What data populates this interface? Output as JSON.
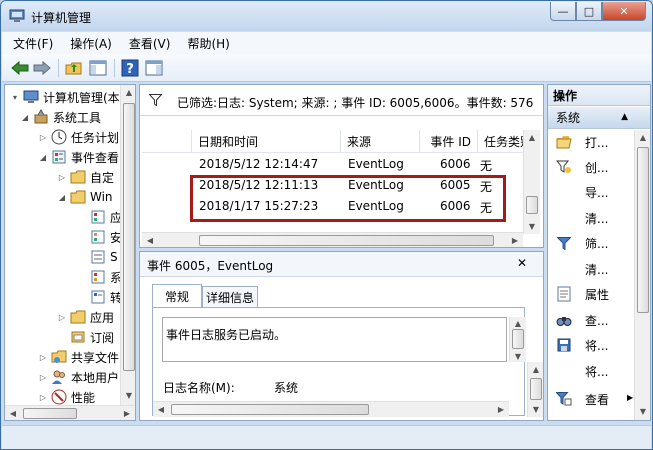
{
  "window": {
    "title": "计算机管理",
    "controls": {
      "minimize": "—",
      "maximize": "□",
      "close": "✕"
    }
  },
  "menu": [
    "文件(F)",
    "操作(A)",
    "查看(V)",
    "帮助(H)"
  ],
  "tree": {
    "items": [
      {
        "label": "计算机管理(本地",
        "icon": "computer-management-icon",
        "expander": "▾"
      },
      {
        "label": "系统工具",
        "icon": "system-tools-icon",
        "expander": "◢"
      },
      {
        "label": "任务计划",
        "icon": "clock-icon",
        "expander": "▷"
      },
      {
        "label": "事件查看",
        "icon": "event-viewer-icon",
        "expander": "◢"
      },
      {
        "label": "自定",
        "icon": "folder-icon",
        "expander": "▷"
      },
      {
        "label": "Win",
        "icon": "folder-icon",
        "expander": "◢"
      },
      {
        "label": "应用",
        "icon": "folder-icon",
        "expander": "▷"
      },
      {
        "label": "订阅",
        "icon": "subscription-icon",
        "expander": ""
      },
      {
        "label": "共享文件",
        "icon": "shared-folders-icon",
        "expander": "▷"
      },
      {
        "label": "本地用户",
        "icon": "users-icon",
        "expander": "▷"
      },
      {
        "label": "性能",
        "icon": "performance-icon",
        "expander": "▷"
      }
    ],
    "log_letters": [
      "应",
      "安",
      "S",
      "系",
      "转"
    ]
  },
  "filter": {
    "text": "已筛选:日志: System; 来源: ; 事件 ID: 6005,6006。事件数: 576"
  },
  "events": {
    "columns": [
      "日期和时间",
      "来源",
      "事件 ID",
      "任务类别"
    ],
    "rows": [
      {
        "datetime": "2018/5/12 12:14:47",
        "source": "EventLog",
        "id": "6006",
        "category": "无"
      },
      {
        "datetime": "2018/5/12 12:11:13",
        "source": "EventLog",
        "id": "6005",
        "category": "无"
      },
      {
        "datetime": "2018/1/17 15:27:23",
        "source": "EventLog",
        "id": "6006",
        "category": "无"
      }
    ]
  },
  "details": {
    "title": "事件 6005，EventLog",
    "close": "✕",
    "tabs": [
      "常规",
      "详细信息"
    ],
    "description": "事件日志服务已启动。",
    "log_name_label": "日志名称(M):",
    "log_name_value": "系统"
  },
  "actions": {
    "header": "操作",
    "section": "系统",
    "items": [
      {
        "label": "打...",
        "icon": "open-folder-icon"
      },
      {
        "label": "创...",
        "icon": "create-view-icon"
      },
      {
        "label": "导...",
        "icon": ""
      },
      {
        "label": "清...",
        "icon": ""
      },
      {
        "label": "筛...",
        "icon": "filter-icon"
      },
      {
        "label": "清...",
        "icon": ""
      },
      {
        "label": "属性",
        "icon": "properties-icon"
      },
      {
        "label": "查...",
        "icon": "find-icon"
      },
      {
        "label": "将...",
        "icon": "save-icon"
      },
      {
        "label": "将...",
        "icon": ""
      },
      {
        "label": "查看",
        "icon": "view-icon"
      }
    ]
  },
  "colors": {
    "highlight": "#a81a1a",
    "accent": "#3a6ea5"
  }
}
